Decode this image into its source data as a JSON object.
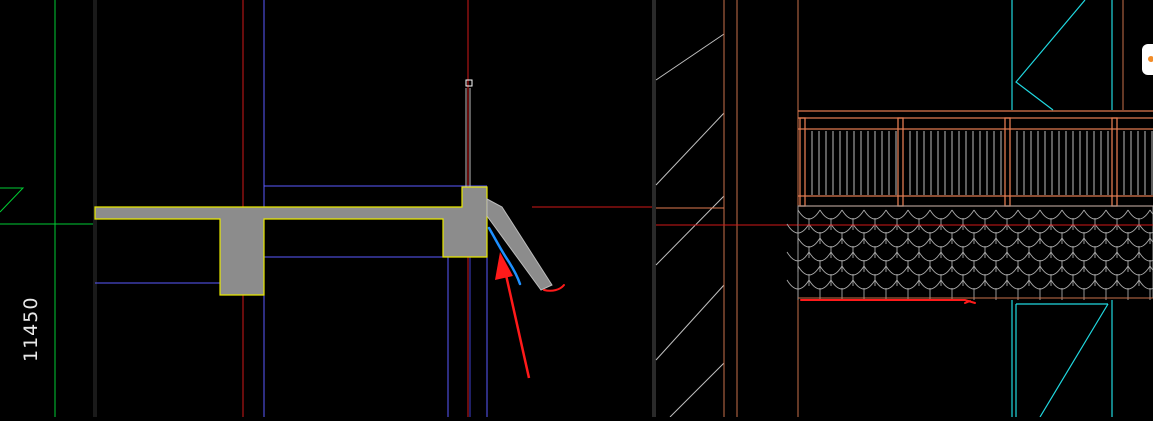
{
  "dimension": {
    "value": "11450"
  },
  "colors": {
    "background": "#000000",
    "grid_green": "#00cc33",
    "axis_red": "#e01818",
    "outline_blue": "#5a5aff",
    "slab_fill": "#8c8c8c",
    "slab_outline": "#e8e800",
    "markup_blue": "#1e90ff",
    "markup_red": "#ff1a1a",
    "railing": "#e07a50",
    "tile": "#9a9a9a",
    "cyan": "#20d8e0",
    "hatch": "#bfbfbf"
  },
  "icons": [
    "annotation-arrow",
    "grip-handle"
  ]
}
